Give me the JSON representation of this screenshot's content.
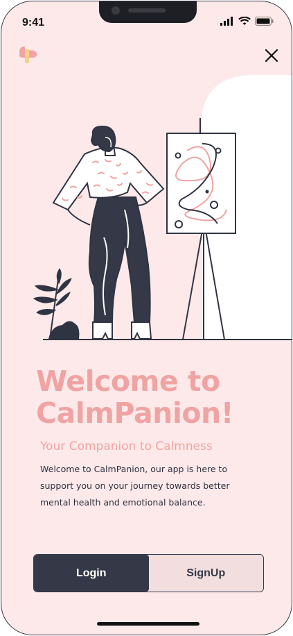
{
  "status_bar": {
    "time": "9:41"
  },
  "icons": {
    "logo": "app-logo",
    "close": "close-icon",
    "signal": "signal-icon",
    "wifi": "wifi-icon",
    "battery": "battery-icon"
  },
  "welcome": {
    "title_line1": "Welcome to",
    "title_line2": "CalmPanion!",
    "subtitle": "Your Companion to Calmness",
    "description": "Welcome to CalmPanion, our app is here to support you on your journey towards better mental health and emotional balance."
  },
  "actions": {
    "login_label": "Login",
    "signup_label": "SignUp"
  },
  "colors": {
    "background": "#fde9e9",
    "accent": "#f0a3a3",
    "dark": "#343847"
  }
}
